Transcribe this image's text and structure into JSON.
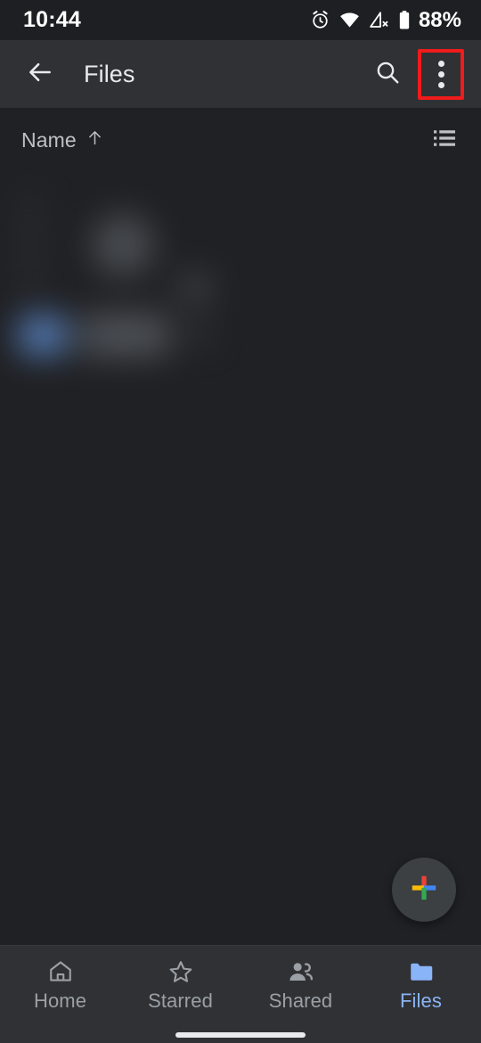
{
  "status_bar": {
    "time": "10:44",
    "battery_percent": "88%",
    "icons": [
      "alarm-icon",
      "wifi-icon",
      "mobile-signal-off-icon",
      "battery-icon"
    ]
  },
  "app_bar": {
    "back_icon": "back-arrow-icon",
    "title": "Files",
    "search_icon": "search-icon",
    "overflow_icon": "more-vert-icon",
    "overflow_highlighted": true,
    "highlight_color": "#f01b1b"
  },
  "sort_row": {
    "sort_label": "Name",
    "sort_direction_icon": "arrow-up-icon",
    "view_toggle_icon": "list-view-icon"
  },
  "content": {
    "state": "blurred",
    "note": "file list content obscured by blur"
  },
  "fab": {
    "icon": "google-plus-icon",
    "colors": {
      "red": "#ea4335",
      "yellow": "#fbbc04",
      "blue": "#4285f4",
      "green": "#34a853"
    },
    "background": "#3c4043"
  },
  "bottom_nav": {
    "active_color": "#8ab4f8",
    "inactive_color": "#9aa0a6",
    "items": [
      {
        "label": "Home",
        "icon": "home-icon",
        "active": false
      },
      {
        "label": "Starred",
        "icon": "star-icon",
        "active": false
      },
      {
        "label": "Shared",
        "icon": "people-icon",
        "active": false
      },
      {
        "label": "Files",
        "icon": "folder-icon",
        "active": true
      }
    ]
  },
  "theme": {
    "status_bar_bg": "#1e1f22",
    "app_bar_bg": "#303134",
    "body_bg": "#202124",
    "text_primary": "#e8eaed",
    "text_secondary": "#bdc1c6"
  }
}
